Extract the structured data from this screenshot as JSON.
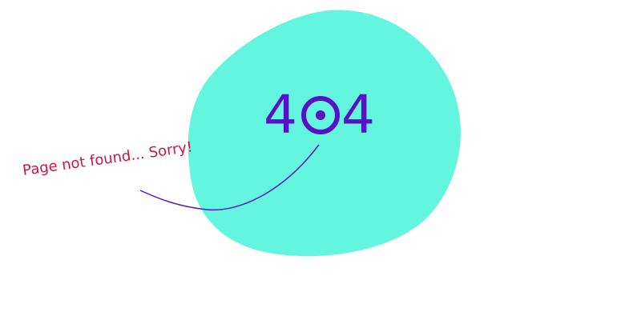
{
  "error": {
    "code_first": "4",
    "code_last": "4",
    "code_middle_icon": "ring-dot-zero-icon",
    "message": "Page not found... Sorry!"
  },
  "colors": {
    "blob": "#64F5DF",
    "code": "#5A0FC8",
    "message": "#D01442",
    "pointer_line": "#5A0FC8",
    "background": "#FFFFFF"
  }
}
